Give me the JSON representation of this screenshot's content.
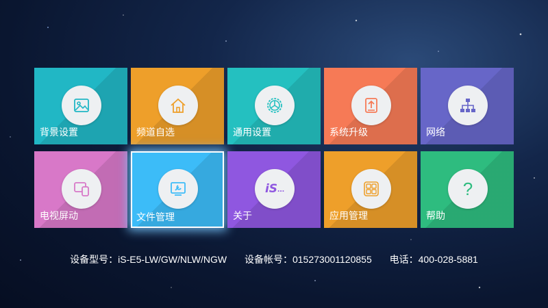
{
  "tiles": [
    {
      "label": "背景设置",
      "icon": "image-icon",
      "color": "#21b7c5"
    },
    {
      "label": "频道自选",
      "icon": "home-icon",
      "color": "#ee9f2a"
    },
    {
      "label": "通用设置",
      "icon": "settings-icon",
      "color": "#24c0c0"
    },
    {
      "label": "系统升级",
      "icon": "upgrade-icon",
      "color": "#f67a56"
    },
    {
      "label": "网络",
      "icon": "network-icon",
      "color": "#6766c8"
    },
    {
      "label": "电视屏动",
      "icon": "screen-devices-icon",
      "color": "#d878c8"
    },
    {
      "label": "文件管理",
      "icon": "monitor-wrench-icon",
      "color": "#3cbcf8"
    },
    {
      "label": "关于",
      "icon": "is-logo-icon",
      "color": "#8f57e0",
      "icon_text": "iS"
    },
    {
      "label": "应用管理",
      "icon": "apps-grid-icon",
      "color": "#ee9f2a"
    },
    {
      "label": "帮助",
      "icon": "help-icon",
      "color": "#2ebc7f",
      "icon_text": "?"
    }
  ],
  "selected_tile": "文件管理",
  "info": {
    "model_label": "设备型号：",
    "model_value": "iS-E5-LW/GW/NLW/NGW",
    "account_label": "设备帐号：",
    "account_value": "015273001120855",
    "phone_label": "电话：",
    "phone_value": "400-028-5881"
  }
}
